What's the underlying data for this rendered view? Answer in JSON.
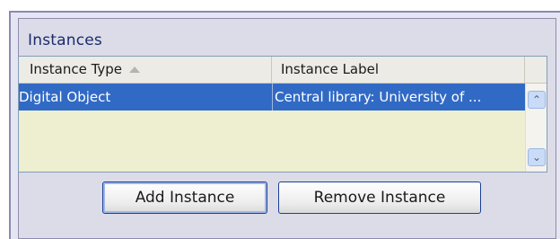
{
  "panel": {
    "title": "Instances"
  },
  "grid": {
    "columns": [
      {
        "label": "Instance Type",
        "sort": "ascending"
      },
      {
        "label": "Instance Label"
      }
    ],
    "rows": [
      {
        "type": "Digital Object",
        "label": "Central library:  University of ...",
        "selected": true
      }
    ]
  },
  "scrollbar": {
    "up_glyph": "⌃",
    "down_glyph": "⌄"
  },
  "buttons": {
    "add_label": "Add Instance",
    "remove_label": "Remove Instance"
  },
  "colors": {
    "selection": "#316ac5",
    "panel_title": "#1c2a6e",
    "grid_background": "#eeeed0"
  },
  "icons": {
    "sort": "sort-ascending-icon",
    "scroll_up": "scroll-up-icon",
    "scroll_down": "scroll-down-icon"
  }
}
